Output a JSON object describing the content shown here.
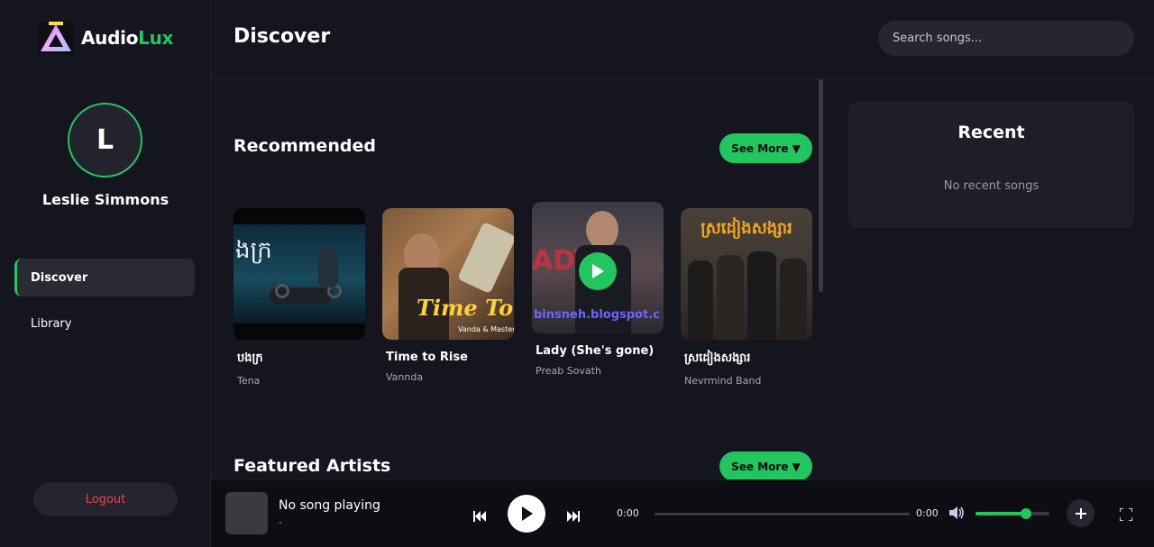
{
  "app": {
    "name_part1": "Audio",
    "name_part2": "Lux",
    "accent": "#22c55e"
  },
  "sidebar": {
    "avatar_initial": "L",
    "user_name": "Leslie Simmons",
    "nav": [
      {
        "label": "Discover",
        "active": true
      },
      {
        "label": "Library",
        "active": false
      }
    ],
    "logout_label": "Logout"
  },
  "header": {
    "title": "Discover",
    "search_placeholder": "Search songs..."
  },
  "recommended": {
    "title": "Recommended",
    "see_more": "See More ▼",
    "songs": [
      {
        "title": "បងក្រ",
        "artist": "Tena",
        "cover_text": "ងក្រ"
      },
      {
        "title": "Time to Rise",
        "artist": "Vannda",
        "cover_text": "Time To R",
        "cover_subtext": "Vanda & Master"
      },
      {
        "title": "Lady (She's gone)",
        "artist": "Preab Sovath",
        "cover_text": "binsneh.blogspot.c",
        "cover_subtext": "ADY"
      },
      {
        "title": "ស្រដៀងសង្សារ",
        "artist": "Nevrmind Band",
        "cover_text": "ស្រដៀងសង្សារ"
      }
    ]
  },
  "featured": {
    "title": "Featured Artists",
    "see_more": "See More ▼"
  },
  "recent": {
    "title": "Recent",
    "empty_text": "No recent songs"
  },
  "player": {
    "now_title": "No song playing",
    "now_artist": "-",
    "time_current": "0:00",
    "time_total": "0:00",
    "progress": 0,
    "volume": 0.68
  }
}
